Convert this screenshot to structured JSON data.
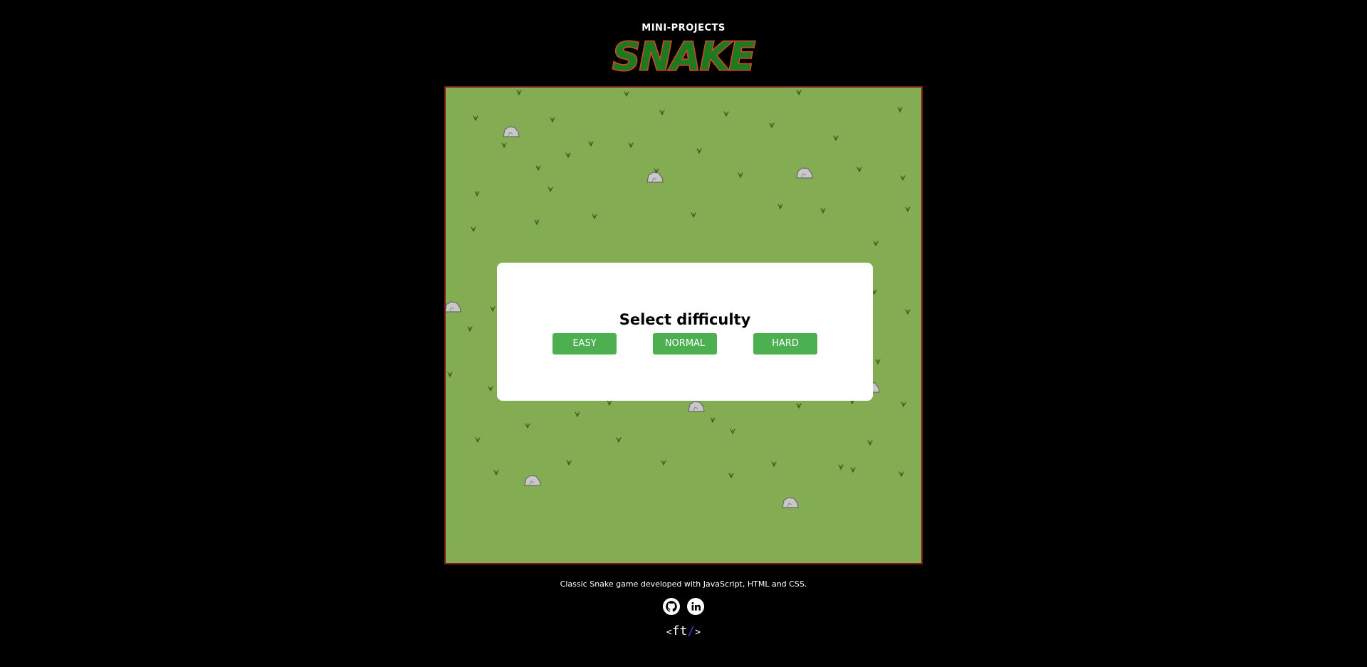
{
  "header": {
    "subtitle": "MINI-PROJECTS",
    "title": "SNAKE"
  },
  "board": {
    "background_color": "#84ac53",
    "border_color": "#7a1a1a"
  },
  "modal": {
    "title": "Select difficulty",
    "buttons": {
      "easy": "EASY",
      "normal": "NORMAL",
      "hard": "HARD"
    },
    "button_color": "#4caf50"
  },
  "footer": {
    "description": "Classic Snake game developed with JavaScript, HTML and CSS.",
    "social": [
      {
        "name": "github-icon"
      },
      {
        "name": "linkedin-icon"
      }
    ],
    "author_logo": {
      "open": "<",
      "text": "ft",
      "slash": "/",
      "close": ">"
    }
  }
}
